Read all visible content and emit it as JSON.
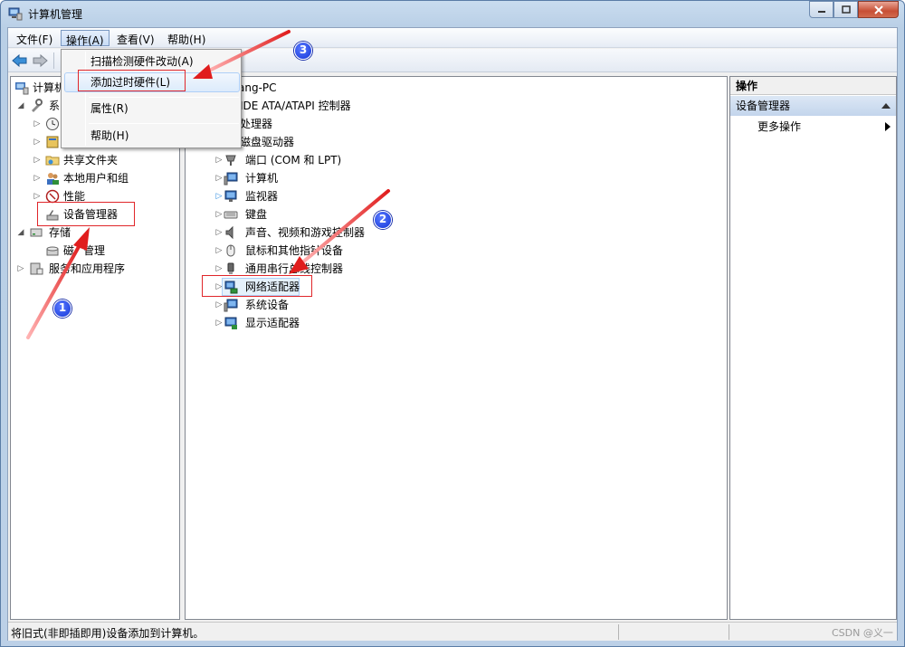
{
  "window": {
    "title": "计算机管理"
  },
  "menubar": {
    "items": [
      "文件(F)",
      "操作(A)",
      "查看(V)",
      "帮助(H)"
    ]
  },
  "action_menu": {
    "items": [
      "扫描检测硬件改动(A)",
      "添加过时硬件(L)",
      "属性(R)",
      "帮助(H)"
    ]
  },
  "left_tree": {
    "root": "计算机",
    "system_tools": "系",
    "shared_folders": "共享文件夹",
    "local_users": "本地用户和组",
    "performance": "性能",
    "device_manager": "设备管理器",
    "storage": "存储",
    "disk_mgmt_a": "磁",
    "disk_mgmt_b": "管理",
    "services": "服务和应用程序"
  },
  "device_tree": {
    "computer_name": "ang-PC",
    "categories": [
      "IDE ATA/ATAPI 控制器",
      "处理器",
      "磁盘驱动器",
      "端口 (COM 和 LPT)",
      "计算机",
      "监视器",
      "键盘",
      "声音、视频和游戏控制器",
      "鼠标和其他指针设备",
      "通用串行总线控制器",
      "网络适配器",
      "系统设备",
      "显示适配器"
    ]
  },
  "actions_pane": {
    "header": "操作",
    "section": "设备管理器",
    "more": "更多操作"
  },
  "statusbar": {
    "text": "将旧式(非即插即用)设备添加到计算机。",
    "watermark": "CSDN @义一"
  },
  "annotations": {
    "badges": [
      "1",
      "2",
      "3"
    ],
    "highlight_color": "#e0262a",
    "badge_color": "#1234d8"
  }
}
